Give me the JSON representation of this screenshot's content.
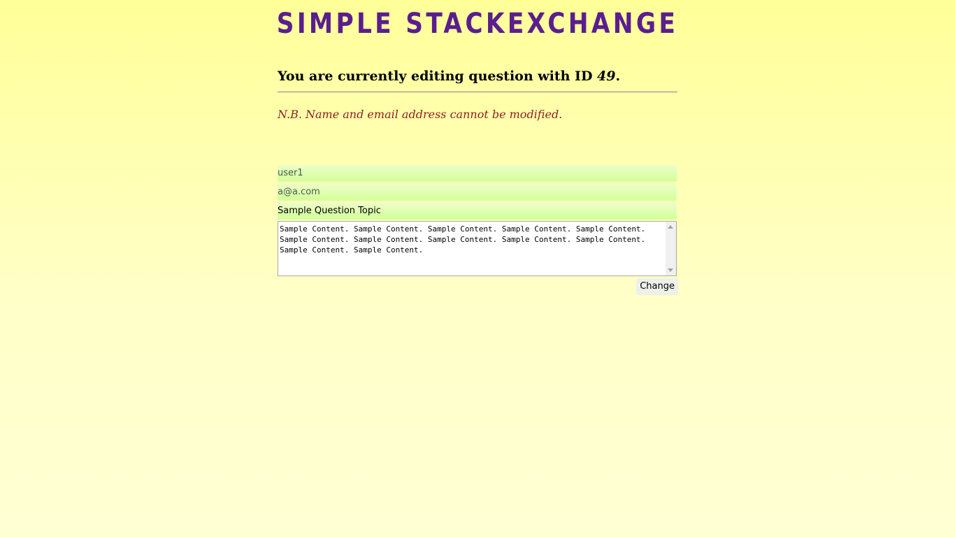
{
  "header": {
    "site_title": "SIMPLE STACKEXCHANGE"
  },
  "edit": {
    "heading_prefix": "You are currently editing question with ID ",
    "question_id": "49",
    "heading_suffix": ".",
    "note": "N.B. Name and email address cannot be modified."
  },
  "form": {
    "name_value": "user1",
    "email_value": "a@a.com",
    "topic_value": "Sample Question Topic",
    "content_value": "Sample Content. Sample Content. Sample Content. Sample Content. Sample Content. Sample Content. Sample Content. Sample Content. Sample Content. Sample Content. Sample Content. Sample Content.",
    "submit_label": "Change"
  },
  "colors": {
    "title": "#5a1e8e",
    "note": "#8b1f1f",
    "field_background": "#d4ff9a",
    "page_background": "#ffff99"
  },
  "icons": {
    "scroll_up": "scroll-up-arrow-icon",
    "scroll_down": "scroll-down-arrow-icon"
  }
}
